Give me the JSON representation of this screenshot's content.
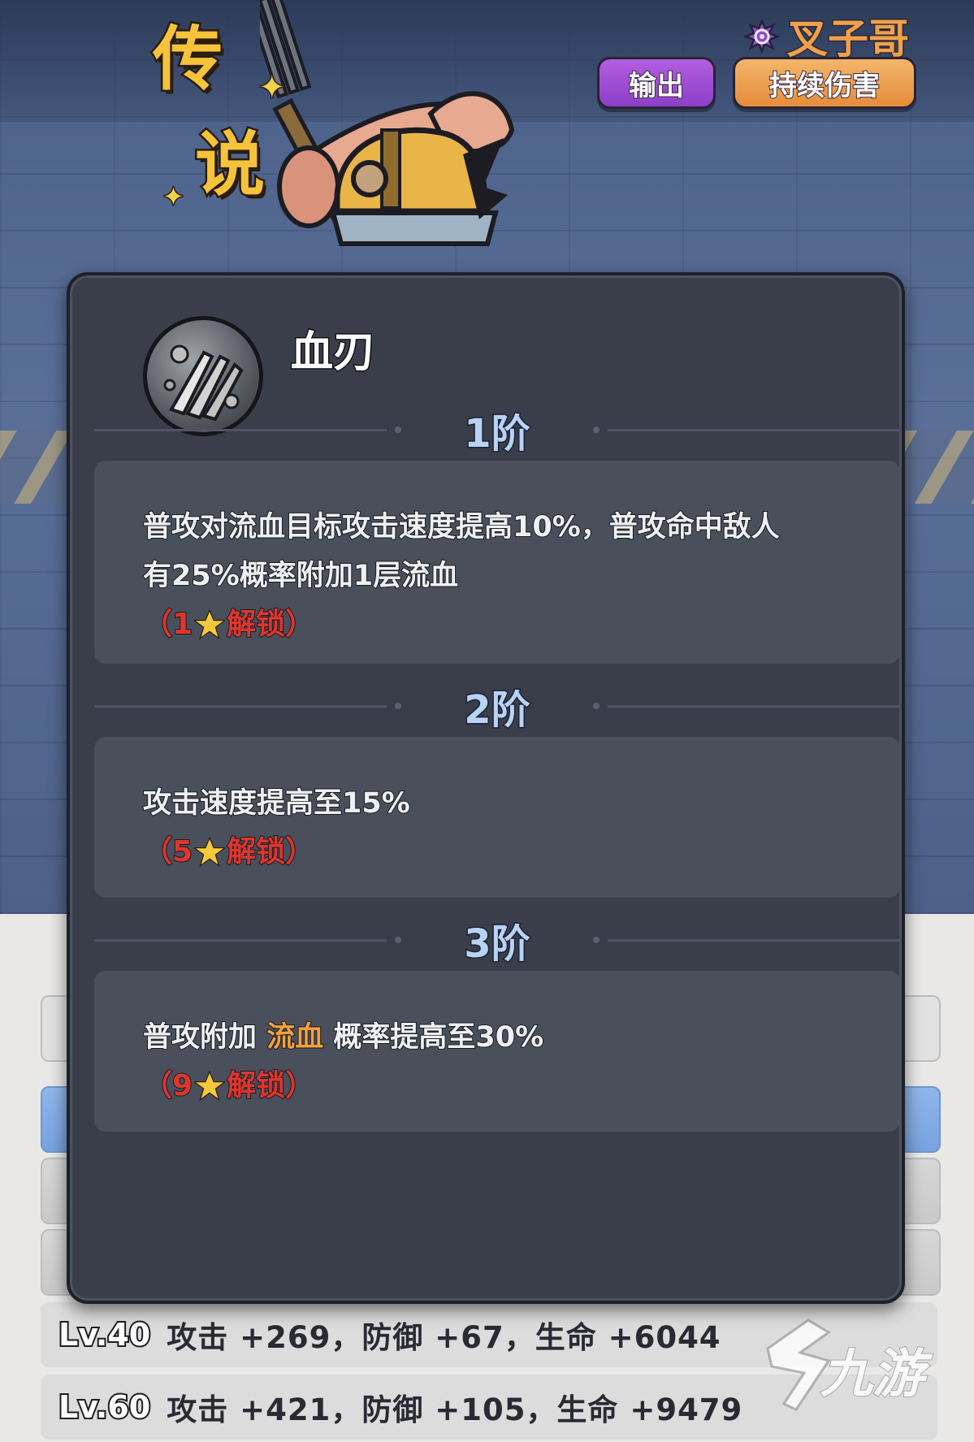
{
  "hero": {
    "legend_badge_line1": "传",
    "legend_badge_line2": "说",
    "name": "叉子哥",
    "tags": [
      "输出",
      "持续伤害"
    ]
  },
  "skill": {
    "title": "血刃",
    "tiers": [
      {
        "label": "1阶",
        "desc_line1": "普攻对流血目标攻击速度提高10%，普攻命中敌人",
        "desc_line2": "有25%概率附加1层流血",
        "unlock_open": "（1",
        "unlock_text": "解锁）"
      },
      {
        "label": "2阶",
        "desc_line1": "攻击速度提高至15%",
        "unlock_open": "（5",
        "unlock_text": "解锁）"
      },
      {
        "label": "3阶",
        "desc_prefix": "普攻附加",
        "desc_highlight": "流血",
        "desc_suffix": "概率提高至30%",
        "unlock_open": "（9",
        "unlock_text": "解锁）"
      }
    ]
  },
  "stats": {
    "rows": [
      {
        "level": "Lv.40",
        "text": "攻击 +269，防御 +67，生命 +6044"
      },
      {
        "level": "Lv.60",
        "text": "攻击 +421，防御 +105，生命 +9479"
      }
    ]
  },
  "watermark": {
    "text": "九游"
  },
  "colors": {
    "modal_bg": "#3a3e4a",
    "tier_box_bg": "#4a4f5c",
    "tier_label": "#b9d2f7",
    "unlock_red": "#e0352d",
    "highlight_orange": "#f4a13c",
    "tag_purple": "#9b4bd2",
    "tag_orange": "#ea9a48",
    "legend_gold": "#f6c33b"
  },
  "icons": {
    "skill": "claw-blade-icon",
    "star": "star-icon",
    "hero_class": "swirl-icon"
  }
}
